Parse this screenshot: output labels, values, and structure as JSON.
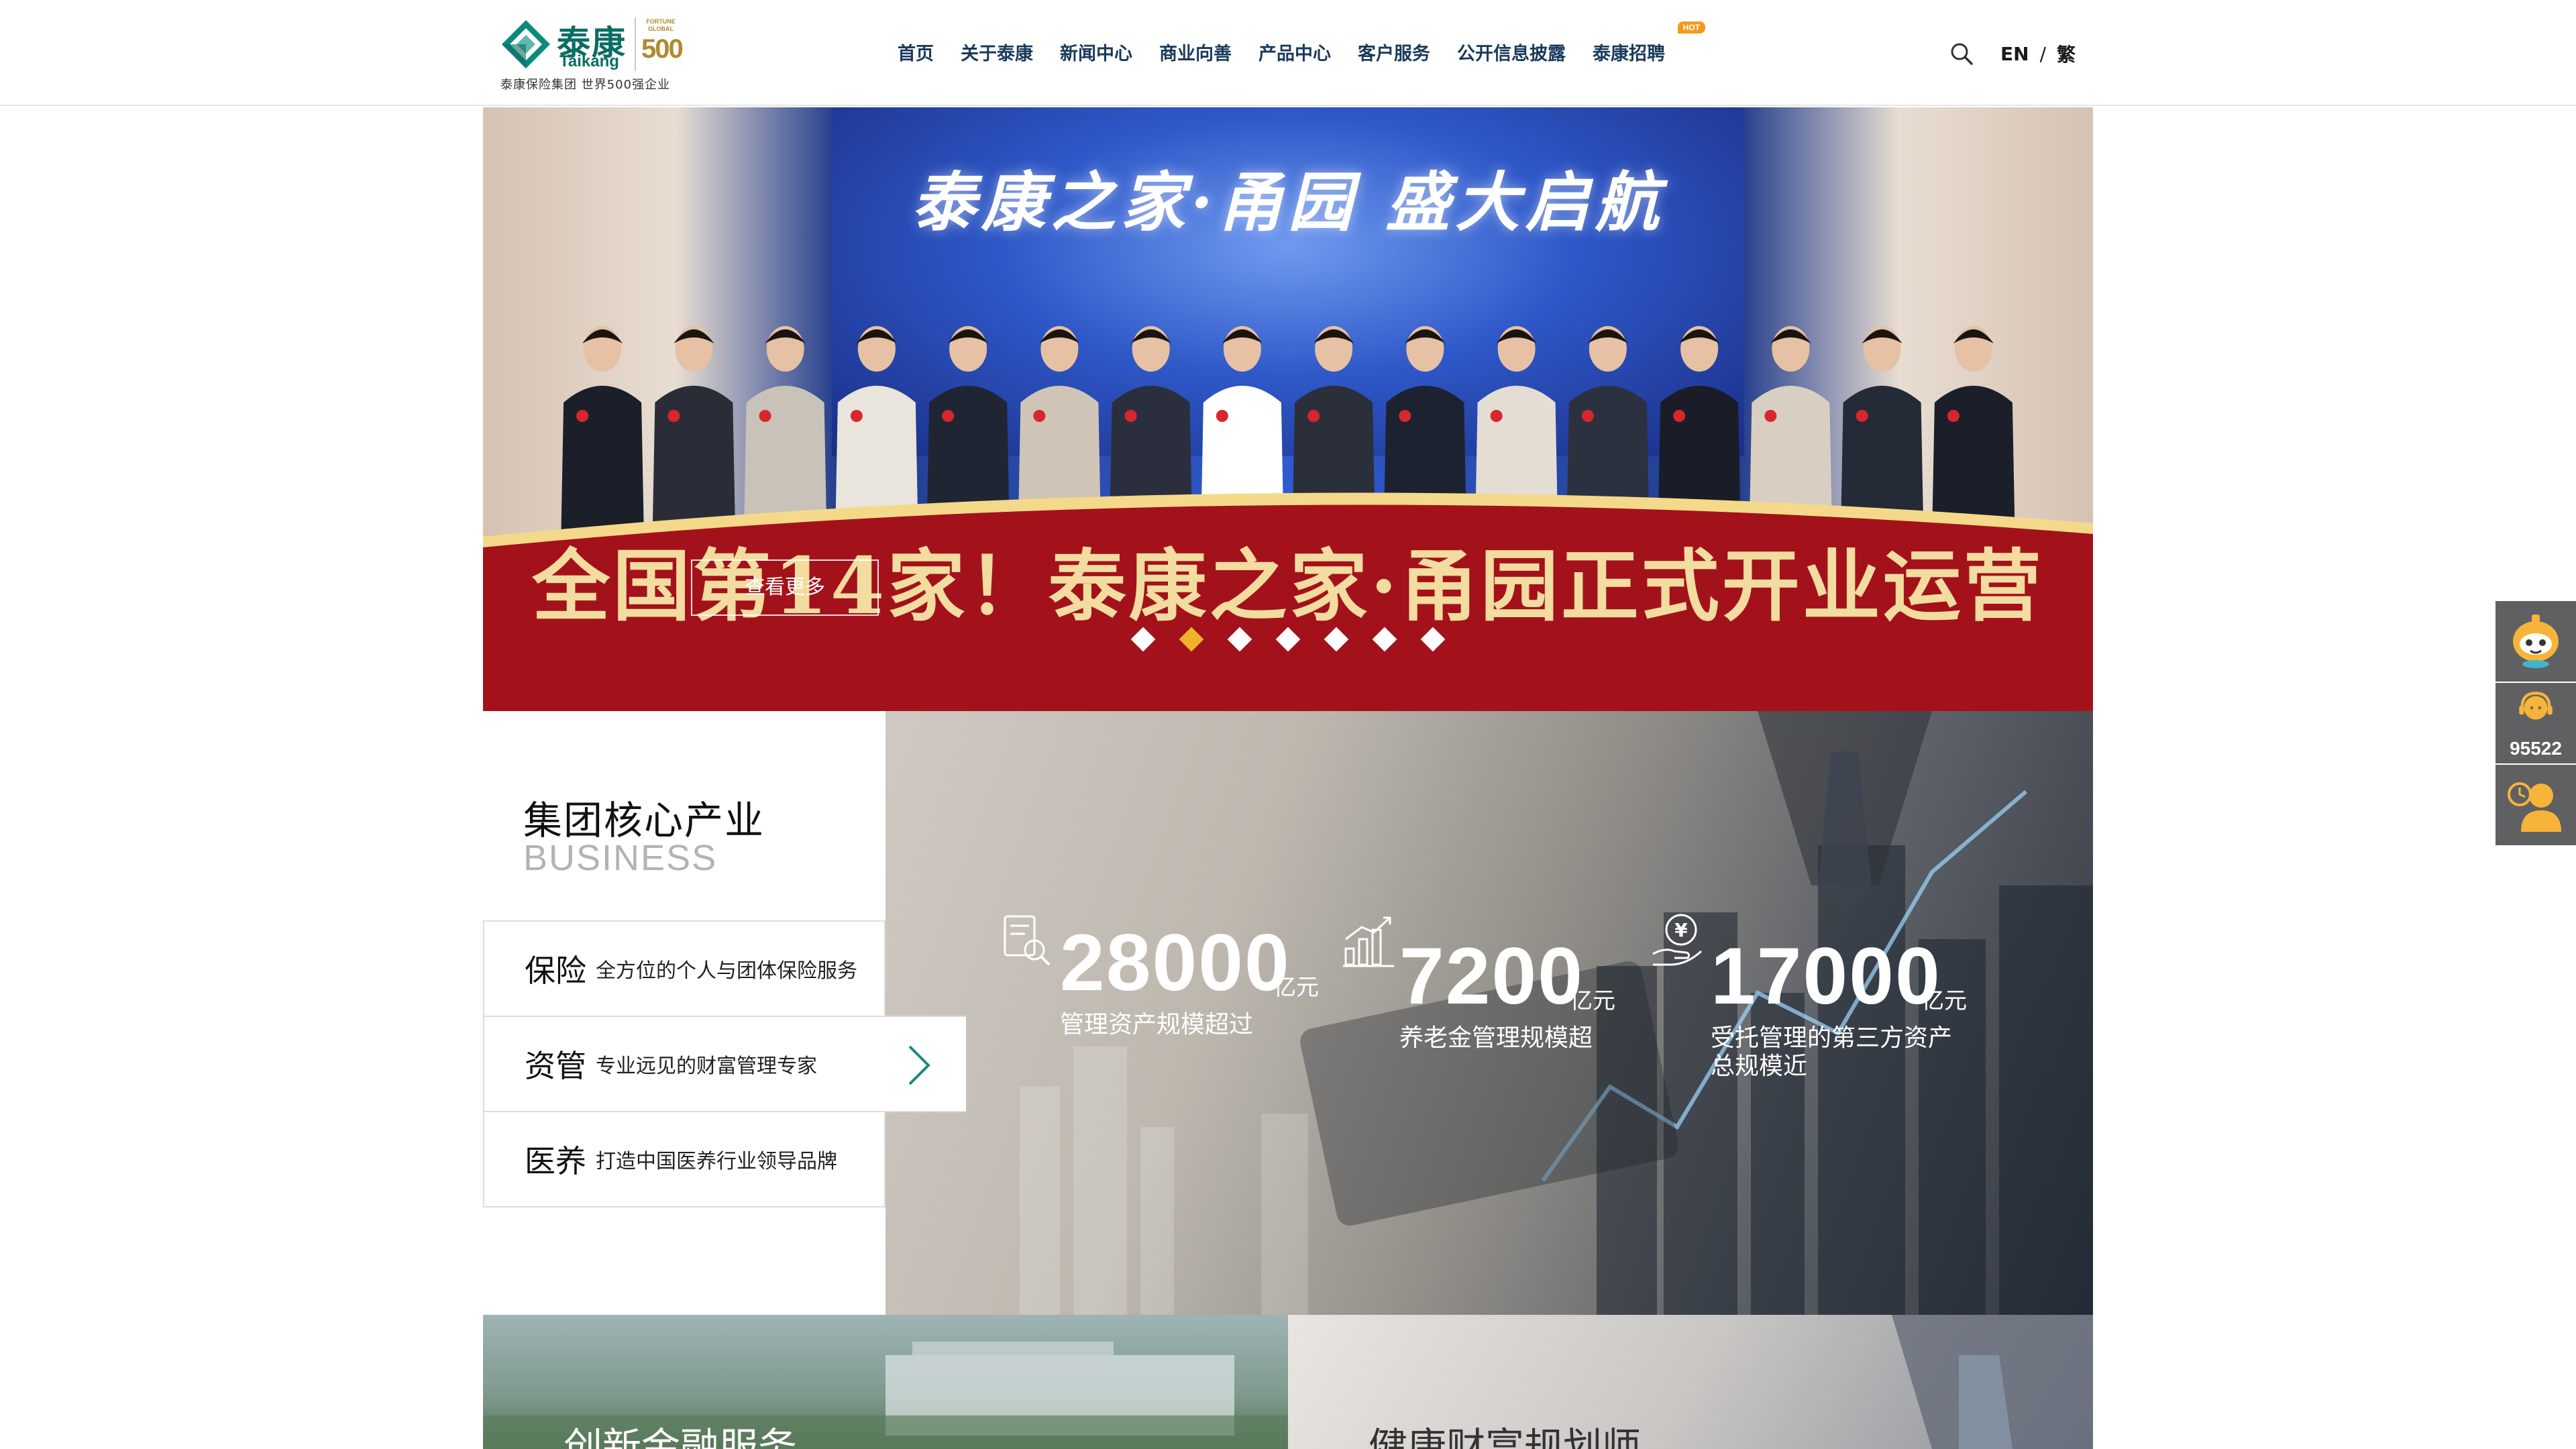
{
  "header": {
    "logo": {
      "cn": "泰康",
      "en": "Taikang",
      "fortune_line1": "FORTUNE",
      "fortune_line2": "GLOBAL",
      "fortune_number": "500",
      "subtitle": "泰康保险集团  世界500强企业"
    },
    "nav": [
      {
        "label": "首页"
      },
      {
        "label": "关于泰康"
      },
      {
        "label": "新闻中心"
      },
      {
        "label": "商业向善"
      },
      {
        "label": "产品中心"
      },
      {
        "label": "客户服务"
      },
      {
        "label": "公开信息披露"
      },
      {
        "label": "泰康招聘",
        "badge": "HOT"
      }
    ],
    "search_icon": "search-icon",
    "lang": {
      "en": "EN",
      "sep": "/",
      "trad": "繁"
    }
  },
  "hero": {
    "stage_title": "泰康之家·甬园 盛大启航",
    "caption": "全国第14家！泰康之家·甬园正式开业运营",
    "more_label": "查看更多",
    "slides_total": 7,
    "active_slide": 2
  },
  "business": {
    "title": "集团核心产业",
    "subtitle": "BUSINESS",
    "items": [
      {
        "title": "保险",
        "desc": "全方位的个人与团体保险服务"
      },
      {
        "title": "资管",
        "desc": "专业远见的财富管理专家",
        "active": true
      },
      {
        "title": "医养",
        "desc": "打造中国医养行业领导品牌"
      }
    ],
    "stats": [
      {
        "value": "28000",
        "unit": "亿元",
        "label": "管理资产规模超过",
        "icon": "document-search-icon"
      },
      {
        "value": "7200",
        "unit": "亿元",
        "label": "养老金管理规模超",
        "icon": "bar-chart-icon"
      },
      {
        "value": "17000",
        "unit": "亿元",
        "label": "受托管理的第三方资产总规模近",
        "label_line1": "受托管理的第三方资产",
        "label_line2": "总规模近",
        "icon": "yuan-hand-icon"
      }
    ]
  },
  "cards": [
    {
      "title": "创新金融服务"
    },
    {
      "title": "健康财富规划师"
    }
  ],
  "side_tools": [
    {
      "name": "chatbot",
      "icon": "robot-assistant-icon"
    },
    {
      "name": "hotline",
      "icon": "customer-service-icon",
      "number": "95522"
    },
    {
      "name": "advisor",
      "icon": "advisor-icon"
    }
  ],
  "colors": {
    "brand_teal": "#0b6d64",
    "nav_text": "#1a3a5c",
    "banner_red": "#a3121b",
    "banner_gold": "#f3dca0",
    "active_dot": "#f0b22b",
    "side_bg": "#5f6062"
  }
}
